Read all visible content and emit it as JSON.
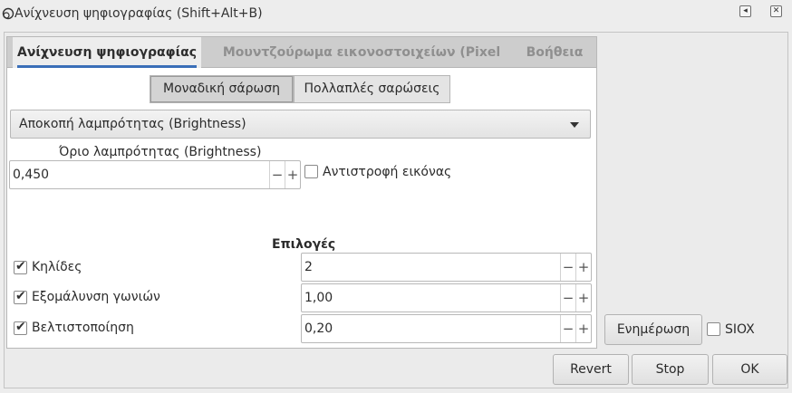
{
  "window": {
    "title": "Ανίχνευση ψηφιογραφίας (Shift+Alt+B)",
    "back_icon": "◂",
    "close_icon": "✕"
  },
  "tabs": [
    {
      "label": "Ανίχνευση ψηφιογραφίας",
      "active": true
    },
    {
      "label": "Μουντζούρωμα εικονοστοιχείων (Pixel art)",
      "active": false
    },
    {
      "label": "Βοήθεια",
      "active": false
    }
  ],
  "scan_mode": {
    "single_label": "Μοναδική σάρωση",
    "multiple_label": "Πολλαπλές σαρώσεις",
    "selected": "single"
  },
  "method_dropdown": {
    "value": "Αποκοπή λαμπρότητας (Brightness)"
  },
  "threshold": {
    "label": "Όριο λαμπρότητας (Brightness)",
    "value": "0,450"
  },
  "invert": {
    "label": "Αντιστροφή εικόνας",
    "checked": false
  },
  "options": {
    "heading": "Επιλογές",
    "speckles": {
      "label": "Κηλίδες",
      "checked": true,
      "value": "2"
    },
    "smooth_corners": {
      "label": "Εξομάλυνση γωνιών",
      "checked": true,
      "value": "1,00"
    },
    "optimize": {
      "label": "Βελτιστοποίηση",
      "checked": true,
      "value": "0,20"
    }
  },
  "side": {
    "update_label": "Ενημέρωση",
    "siox_label": "SIOX",
    "siox_checked": false
  },
  "footer": {
    "revert_label": "Revert",
    "stop_label": "Stop",
    "ok_label": "OK"
  },
  "spin_symbols": {
    "minus": "−",
    "plus": "+"
  }
}
